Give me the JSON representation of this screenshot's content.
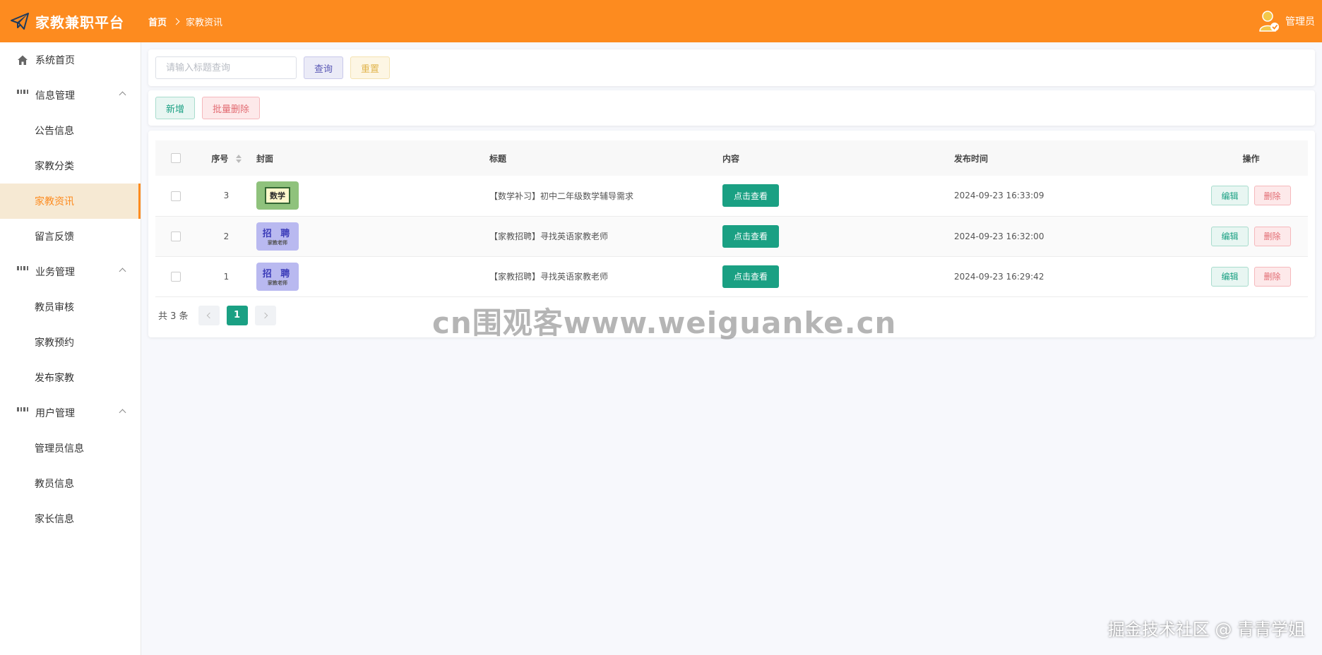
{
  "app": {
    "title": "家教兼职平台",
    "user": "管理员"
  },
  "breadcrumb": {
    "home": "首页",
    "current": "家教资讯"
  },
  "sidebar": {
    "home": "系统首页",
    "groups": [
      {
        "label": "信息管理",
        "items": [
          "公告信息",
          "家教分类",
          "家教资讯",
          "留言反馈"
        ]
      },
      {
        "label": "业务管理",
        "items": [
          "教员审核",
          "家教预约",
          "发布家教"
        ]
      },
      {
        "label": "用户管理",
        "items": [
          "管理员信息",
          "教员信息",
          "家长信息"
        ]
      }
    ],
    "active": "家教资讯"
  },
  "search": {
    "placeholder": "请输入标题查询",
    "query_label": "查询",
    "reset_label": "重置"
  },
  "actions": {
    "add_label": "新增",
    "batch_delete_label": "批量删除"
  },
  "table": {
    "headers": {
      "seq": "序号",
      "cover": "封面",
      "title": "标题",
      "content": "内容",
      "time": "发布时间",
      "op": "操作"
    },
    "rows": [
      {
        "seq": "3",
        "cover": "数学",
        "title": "【数学补习】初中二年级数学辅导需求",
        "view_label": "点击查看",
        "time": "2024-09-23 16:33:09",
        "edit_label": "编辑",
        "delete_label": "删除"
      },
      {
        "seq": "2",
        "cover": "招 聘",
        "cover_sub": "家教老师",
        "title": "【家教招聘】寻找英语家教老师",
        "view_label": "点击查看",
        "time": "2024-09-23 16:32:00",
        "edit_label": "编辑",
        "delete_label": "删除"
      },
      {
        "seq": "1",
        "cover": "招 聘",
        "cover_sub": "家教老师",
        "title": "【家教招聘】寻找英语家教老师",
        "view_label": "点击查看",
        "time": "2024-09-23 16:29:42",
        "edit_label": "编辑",
        "delete_label": "删除"
      }
    ]
  },
  "pagination": {
    "total": "共 3 条",
    "current_page": "1"
  },
  "watermark": {
    "center": "cn围观客www.weiguanke.cn",
    "corner": "掘金技术社区 @ 青青学姐"
  },
  "colors": {
    "header": "#fd8b1f",
    "primary": "#1aa083",
    "danger": "#e26b72"
  }
}
